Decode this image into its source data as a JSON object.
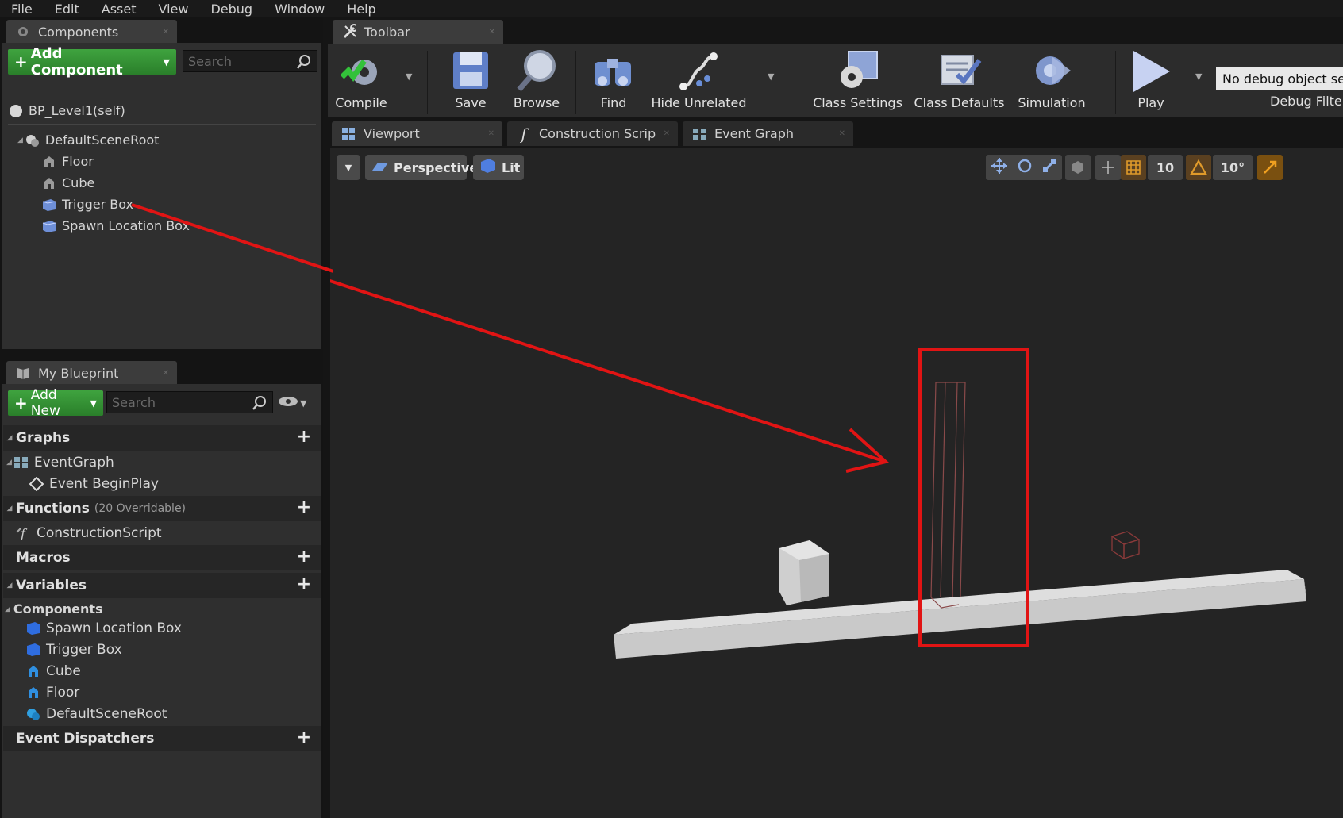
{
  "menu": [
    "File",
    "Edit",
    "Asset",
    "View",
    "Debug",
    "Window",
    "Help"
  ],
  "components_panel": {
    "tab": "Components",
    "add_button": "Add Component",
    "search_placeholder": "Search",
    "self": "BP_Level1(self)",
    "tree": {
      "root": "DefaultSceneRoot",
      "children": [
        "Floor",
        "Cube",
        "Trigger Box",
        "Spawn Location Box"
      ]
    }
  },
  "my_blueprint": {
    "tab": "My Blueprint",
    "add_button": "Add New",
    "search_placeholder": "Search",
    "graphs": {
      "label": "Graphs",
      "event_graph": "EventGraph",
      "event": "Event BeginPlay"
    },
    "functions": {
      "label": "Functions",
      "sub": "(20 Overridable)",
      "item": "ConstructionScript"
    },
    "macros": "Macros",
    "variables": {
      "label": "Variables",
      "components_label": "Components",
      "items": [
        "Spawn Location Box",
        "Trigger Box",
        "Cube",
        "Floor",
        "DefaultSceneRoot"
      ]
    },
    "dispatchers": "Event Dispatchers"
  },
  "toolbar": {
    "tab": "Toolbar",
    "buttons": {
      "compile": "Compile",
      "save": "Save",
      "browse": "Browse",
      "find": "Find",
      "hide_unrelated": "Hide Unrelated",
      "class_settings": "Class Settings",
      "class_defaults": "Class Defaults",
      "simulation": "Simulation",
      "play": "Play"
    },
    "debug_object": "No debug object sel",
    "debug_filter": "Debug Filte"
  },
  "doc_tabs": [
    "Viewport",
    "Construction Scrip",
    "Event Graph"
  ],
  "viewport": {
    "perspective": "Perspective",
    "lit": "Lit",
    "grid_snap": "10",
    "rot_snap": "10°"
  },
  "annotation_color": "#e11414"
}
